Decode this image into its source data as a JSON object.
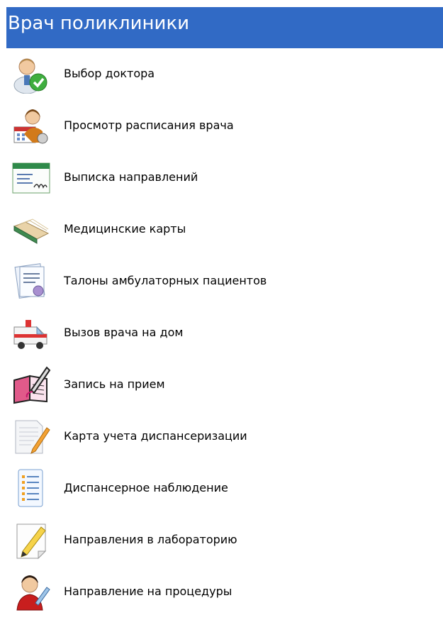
{
  "header": {
    "title": "Врач поликлиники"
  },
  "menu": {
    "items": [
      {
        "label": "Выбор доктора",
        "icon": "doctor-checkmark-icon"
      },
      {
        "label": "Просмотр расписания врача",
        "icon": "doctor-calendar-icon"
      },
      {
        "label": "Выписка направлений",
        "icon": "referral-form-icon"
      },
      {
        "label": "Медицинские карты",
        "icon": "medical-cards-icon"
      },
      {
        "label": "Талоны амбулаторных пациентов",
        "icon": "outpatient-coupon-icon"
      },
      {
        "label": "Вызов врача на дом",
        "icon": "ambulance-icon"
      },
      {
        "label": "Запись на прием",
        "icon": "appointment-book-icon"
      },
      {
        "label": "Карта учета диспансеризации",
        "icon": "document-pencil-icon"
      },
      {
        "label": "Диспансерное наблюдение",
        "icon": "checklist-icon"
      },
      {
        "label": "Направления в лабораторию",
        "icon": "edit-note-icon"
      },
      {
        "label": "Направление на процедуры",
        "icon": "nurse-procedure-icon"
      }
    ]
  }
}
